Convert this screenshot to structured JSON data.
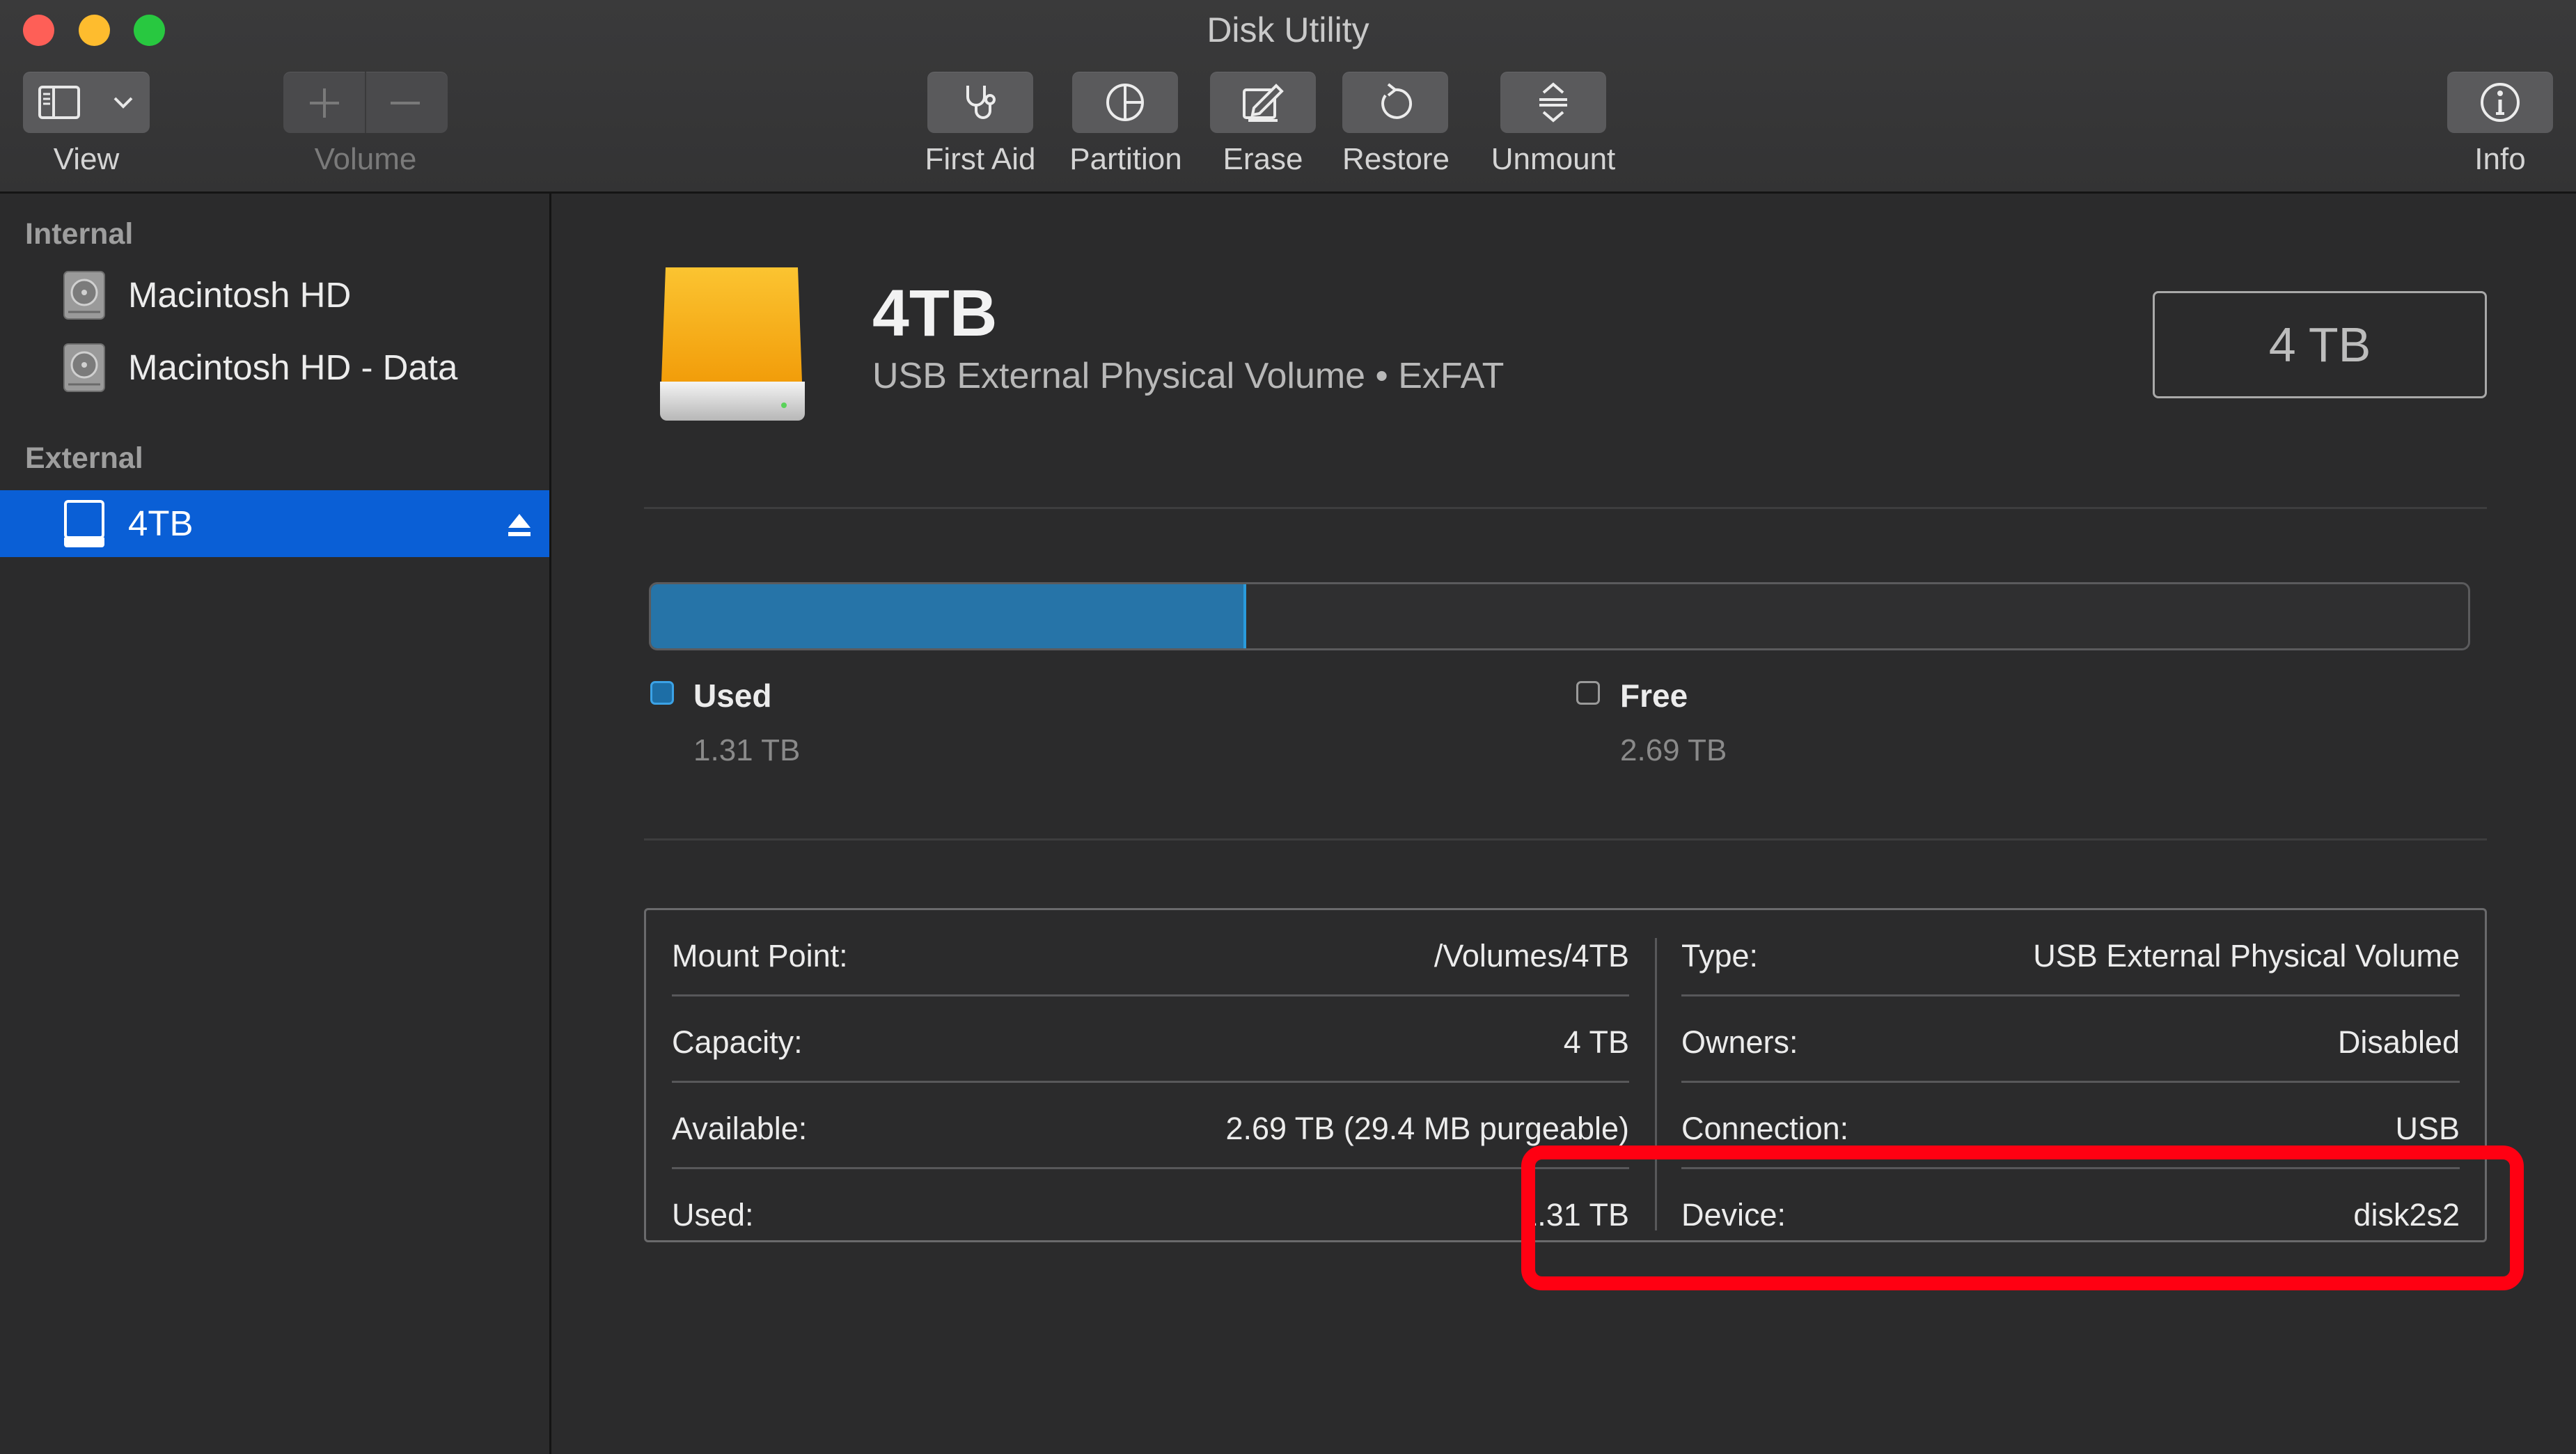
{
  "window": {
    "title": "Disk Utility"
  },
  "toolbar": {
    "view_label": "View",
    "volume_label": "Volume",
    "first_aid_label": "First Aid",
    "partition_label": "Partition",
    "erase_label": "Erase",
    "restore_label": "Restore",
    "unmount_label": "Unmount",
    "info_label": "Info"
  },
  "sidebar": {
    "internal_header": "Internal",
    "external_header": "External",
    "internal_items": [
      {
        "label": "Macintosh HD",
        "icon": "internal-disk-icon"
      },
      {
        "label": "Macintosh HD - Data",
        "icon": "internal-disk-icon"
      }
    ],
    "external_items": [
      {
        "label": "4TB",
        "icon": "external-disk-icon",
        "selected": true
      }
    ]
  },
  "volume": {
    "name": "4TB",
    "description": "USB External Physical Volume • ExFAT",
    "capacity": "4 TB",
    "used_fraction": 0.3275
  },
  "usage": {
    "used_label": "Used",
    "used_value": "1.31 TB",
    "free_label": "Free",
    "free_value": "2.69 TB"
  },
  "info": {
    "left": [
      {
        "key": "Mount Point:",
        "value": "/Volumes/4TB"
      },
      {
        "key": "Capacity:",
        "value": "4 TB"
      },
      {
        "key": "Available:",
        "value": "2.69 TB (29.4 MB purgeable)"
      },
      {
        "key": "Used:",
        "value": "1.31 TB"
      }
    ],
    "right": [
      {
        "key": "Type:",
        "value": "USB External Physical Volume"
      },
      {
        "key": "Owners:",
        "value": "Disabled"
      },
      {
        "key": "Connection:",
        "value": "USB"
      },
      {
        "key": "Device:",
        "value": "disk2s2"
      }
    ]
  },
  "colors": {
    "selection": "#0a5fd6",
    "used_fill": "#2674a8",
    "highlight": "#ff0012",
    "disk_orange": "#f5a614"
  }
}
